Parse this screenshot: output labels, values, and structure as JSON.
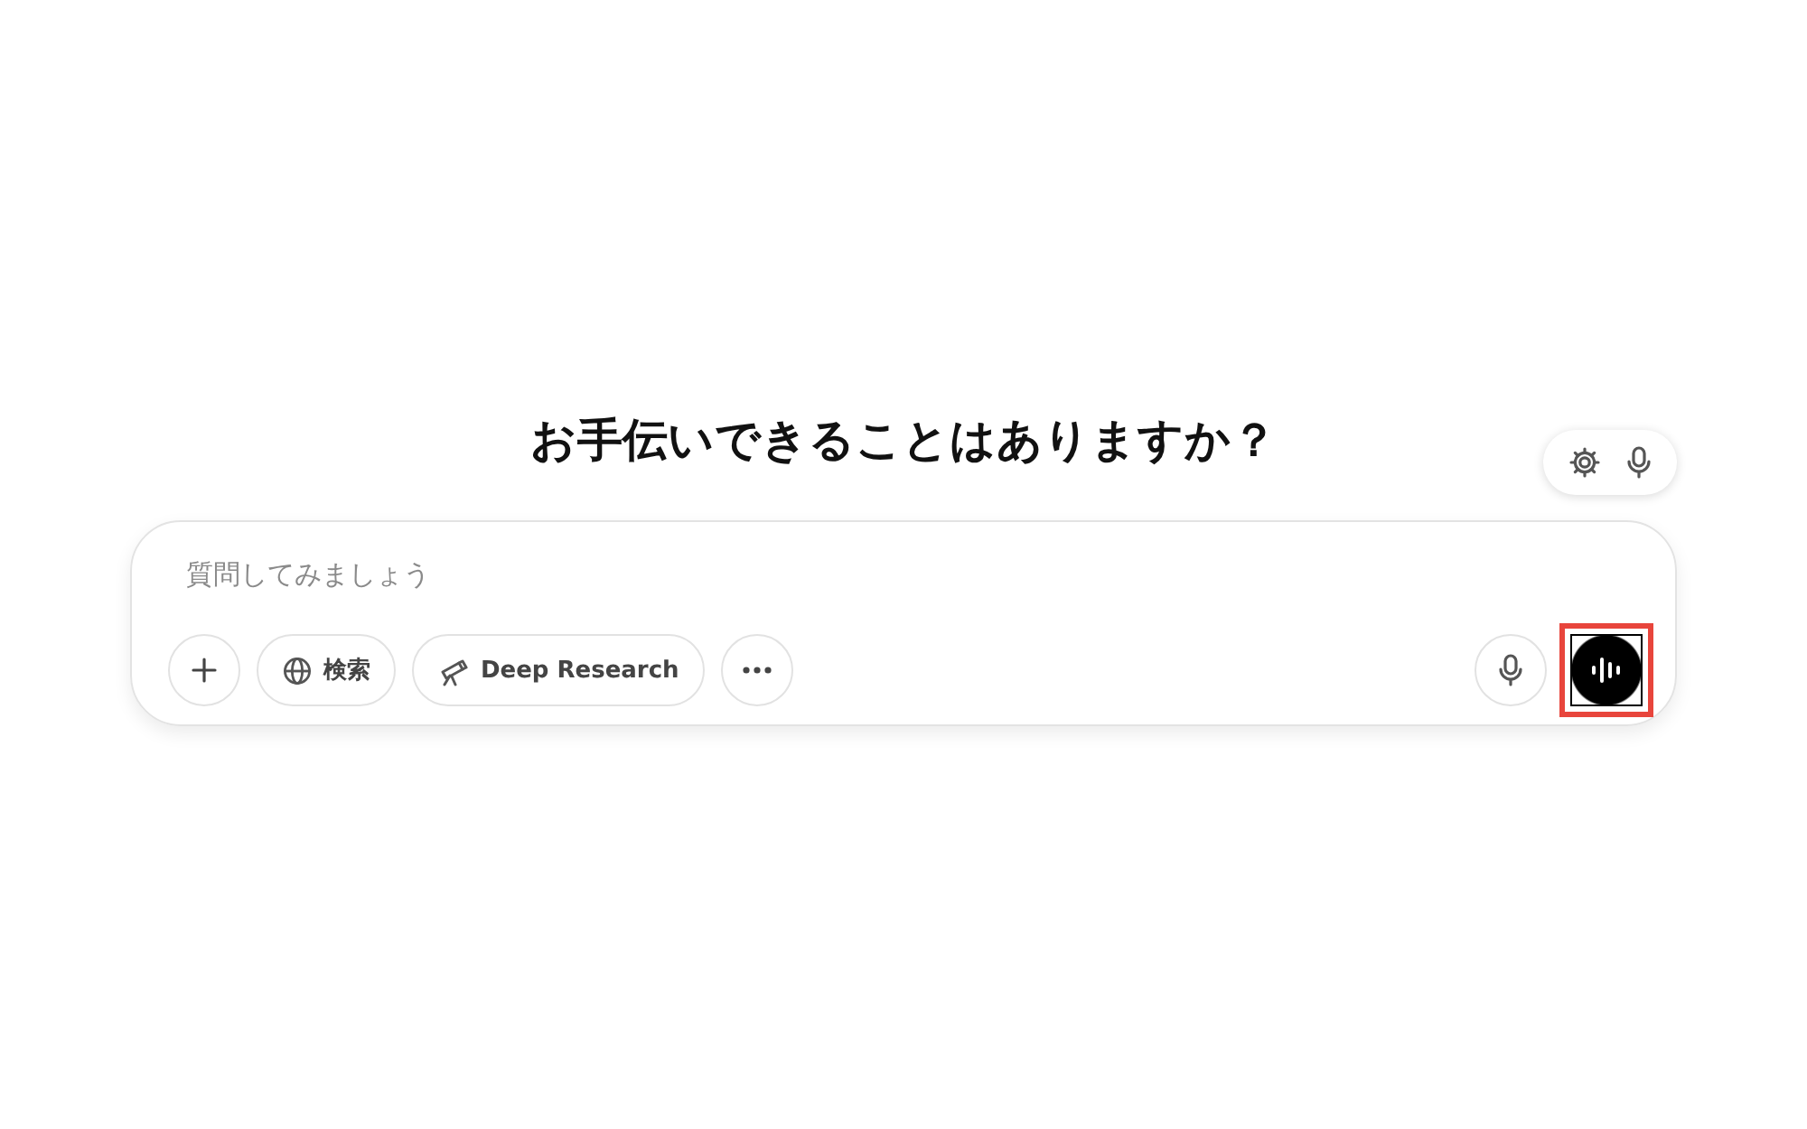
{
  "heading": "お手伝いできることはありますか？",
  "floating_controls": [
    {
      "kind": "settings"
    },
    {
      "kind": "mic"
    }
  ],
  "composer": {
    "placeholder": "質問してみましょう",
    "tools": [
      {
        "kind": "add"
      },
      {
        "kind": "globe",
        "label": "検索"
      },
      {
        "kind": "telescope",
        "label": "Deep Research"
      },
      {
        "kind": "more"
      }
    ],
    "actions": [
      {
        "kind": "mic",
        "highlighted": false
      },
      {
        "kind": "voice",
        "highlighted": true
      }
    ]
  }
}
